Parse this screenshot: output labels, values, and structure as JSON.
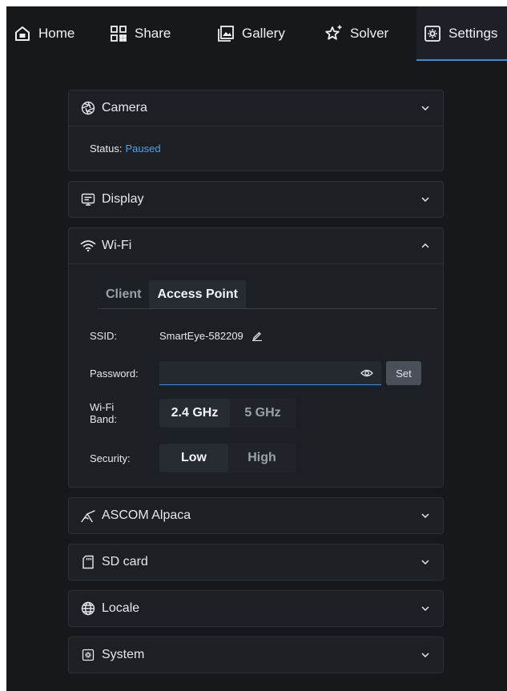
{
  "nav": {
    "items": [
      {
        "label": "Home",
        "icon": "home-icon"
      },
      {
        "label": "Share",
        "icon": "qr-code-icon"
      },
      {
        "label": "Gallery",
        "icon": "gallery-icon"
      },
      {
        "label": "Solver",
        "icon": "sparkle-star-icon"
      },
      {
        "label": "Settings",
        "icon": "settings-icon"
      }
    ],
    "active": "Settings"
  },
  "colors": {
    "background": "#16181c",
    "panel": "#1c1f24",
    "accent": "#3d8bd8",
    "status_link": "#4aa3f0"
  },
  "panels": {
    "camera": {
      "title": "Camera",
      "icon": "aperture-icon",
      "status_label": "Status:",
      "status_value": "Paused"
    },
    "display": {
      "title": "Display",
      "icon": "display-icon"
    },
    "wifi": {
      "title": "Wi-Fi",
      "icon": "wifi-icon",
      "tabs": [
        "Client",
        "Access Point"
      ],
      "active_tab": "Access Point",
      "ssid_label": "SSID:",
      "ssid_value": "SmartEye-582209",
      "password_label": "Password:",
      "password_value": "",
      "set_label": "Set",
      "band_label": "Wi-Fi\nBand:",
      "band_options": [
        "2.4 GHz",
        "5 GHz"
      ],
      "band_selected": "2.4 GHz",
      "security_label": "Security:",
      "security_options": [
        "Low",
        "High"
      ],
      "security_selected": "Low"
    },
    "ascom": {
      "title": "ASCOM Alpaca",
      "icon": "telescope-icon"
    },
    "sd": {
      "title": "SD card",
      "icon": "sd-card-icon"
    },
    "locale": {
      "title": "Locale",
      "icon": "globe-icon"
    },
    "system": {
      "title": "System",
      "icon": "system-icon"
    }
  }
}
